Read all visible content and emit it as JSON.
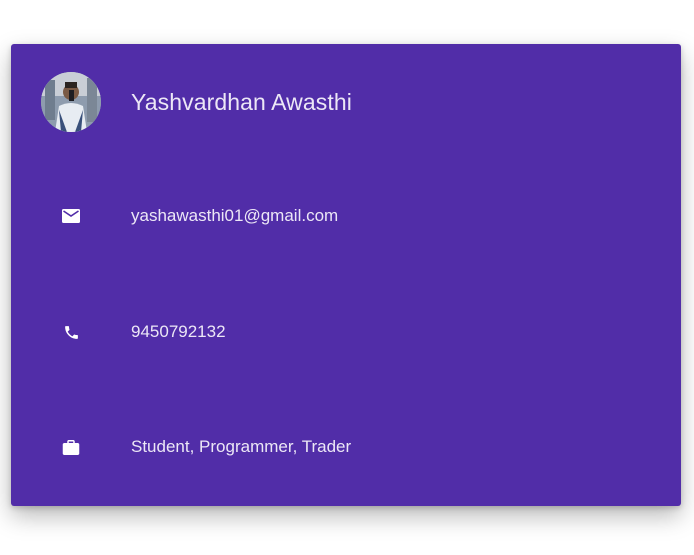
{
  "profile": {
    "name": "Yashvardhan Awasthi",
    "avatar_icon": "user-photo"
  },
  "details": [
    {
      "icon": "email-icon",
      "value": "yashawasthi01@gmail.com"
    },
    {
      "icon": "phone-icon",
      "value": "9450792132"
    },
    {
      "icon": "briefcase-icon",
      "value": "Student, Programmer, Trader"
    }
  ],
  "colors": {
    "card_background": "#512da8",
    "text": "#ece7f6",
    "icon": "#ffffff"
  }
}
